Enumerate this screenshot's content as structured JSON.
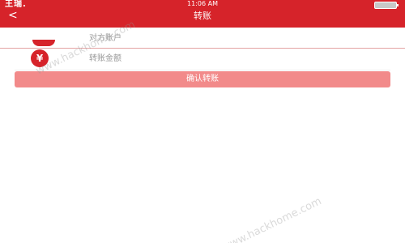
{
  "status_bar": {
    "left_text": "王瑞.",
    "time": "11:06 AM"
  },
  "nav": {
    "back_symbol": "<",
    "title": "转账"
  },
  "form": {
    "recipient_placeholder": "对方账户",
    "amount_placeholder": "转账金额"
  },
  "confirm_button": {
    "label": "确认转账"
  },
  "watermark": {
    "text_1": "www.hackhome.com",
    "text_2": "www.hackhome.com"
  },
  "colors": {
    "header": "#d6232a",
    "button": "#f28a8a",
    "accent": "#d6232a"
  },
  "icons": {
    "recipient": "user-avatar-icon",
    "amount": "yuan-icon",
    "back": "back-chevron-icon",
    "battery": "battery-icon"
  }
}
